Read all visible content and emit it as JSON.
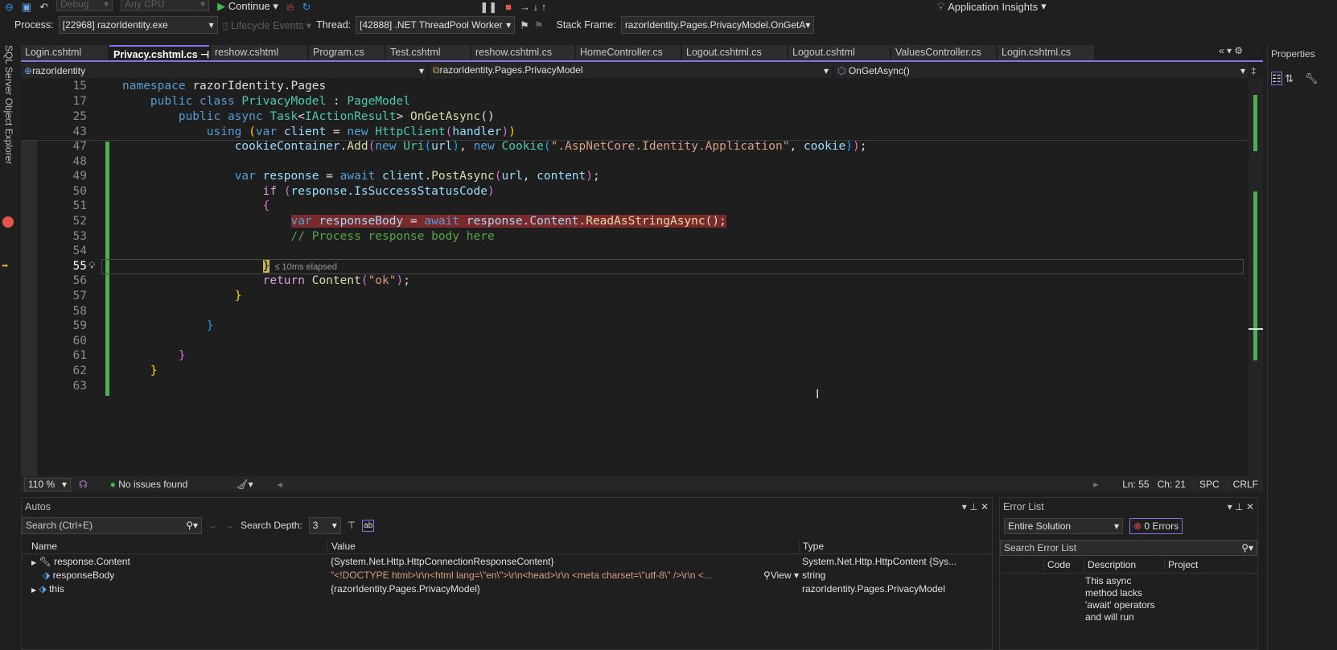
{
  "toolbar": {
    "config": "Debug",
    "platform": "Any CPU",
    "continue": "Continue",
    "app_insights": "Application Insights"
  },
  "debugbar": {
    "process_label": "Process:",
    "process": "[22968] razorIdentity.exe",
    "lifecycle": "Lifecycle Events",
    "thread_label": "Thread:",
    "thread": "[42888] .NET ThreadPool Worker",
    "stack_label": "Stack Frame:",
    "stack": "razorIdentity.Pages.PrivacyModel.OnGetA"
  },
  "left_strip": "SQL Server Object Explorer",
  "tabs": [
    "Login.cshtml",
    "Privacy.cshtml.cs",
    "reshow.cshtml",
    "Program.cs",
    "Test.cshtml",
    "reshow.cshtml.cs",
    "HomeController.cs",
    "Logout.cshtml.cs",
    "Logout.cshtml",
    "ValuesController.cs",
    "Login.cshtml.cs"
  ],
  "navbar": {
    "project": "razorIdentity",
    "type": "razorIdentity.Pages.PrivacyModel",
    "member": "OnGetAsync()"
  },
  "properties": {
    "title": "Properties"
  },
  "sticky": [
    {
      "n": "15",
      "t": [
        [
          "kw",
          "namespace "
        ],
        [
          "pl",
          "razorIdentity.Pages"
        ]
      ]
    },
    {
      "n": "17",
      "t": [
        [
          "pl",
          "    "
        ],
        [
          "kw",
          "public class "
        ],
        [
          "ty",
          "PrivacyModel"
        ],
        [
          "pl",
          " : "
        ],
        [
          "ty",
          "PageModel"
        ]
      ]
    },
    {
      "n": "25",
      "t": [
        [
          "pl",
          "        "
        ],
        [
          "kw",
          "public async "
        ],
        [
          "ty",
          "Task"
        ],
        [
          "pl",
          "<"
        ],
        [
          "ty",
          "IActionResult"
        ],
        [
          "pl",
          "> "
        ],
        [
          "me",
          "OnGetAsync"
        ],
        [
          "pl",
          "()"
        ]
      ]
    },
    {
      "n": "43",
      "t": [
        [
          "pl",
          "            "
        ],
        [
          "kw",
          "using "
        ],
        [
          "br1",
          "("
        ],
        [
          "kw",
          "var "
        ],
        [
          "va",
          "client"
        ],
        [
          "pl",
          " = "
        ],
        [
          "kw",
          "new "
        ],
        [
          "ty",
          "HttpClient"
        ],
        [
          "br2",
          "("
        ],
        [
          "va",
          "handler"
        ],
        [
          "br2",
          ")"
        ],
        [
          "br1",
          ")"
        ]
      ]
    }
  ],
  "code": [
    {
      "n": "47",
      "t": [
        [
          "pl",
          "                "
        ],
        [
          "va",
          "cookieContainer"
        ],
        [
          "pl",
          "."
        ],
        [
          "me",
          "Add"
        ],
        [
          "br2",
          "("
        ],
        [
          "kw",
          "new "
        ],
        [
          "ty",
          "Uri"
        ],
        [
          "br3",
          "("
        ],
        [
          "va",
          "url"
        ],
        [
          "br3",
          ")"
        ],
        [
          "pl",
          ", "
        ],
        [
          "kw",
          "new "
        ],
        [
          "ty",
          "Cookie"
        ],
        [
          "br3",
          "("
        ],
        [
          "st",
          "\".AspNetCore.Identity.Application\""
        ],
        [
          "pl",
          ", "
        ],
        [
          "va",
          "cookie"
        ],
        [
          "br3",
          ")"
        ],
        [
          "br2",
          ")"
        ],
        [
          "pl",
          ";"
        ]
      ]
    },
    {
      "n": "48",
      "t": []
    },
    {
      "n": "49",
      "t": [
        [
          "pl",
          "                "
        ],
        [
          "kw",
          "var "
        ],
        [
          "va",
          "response"
        ],
        [
          "pl",
          " = "
        ],
        [
          "kw",
          "await "
        ],
        [
          "va",
          "client"
        ],
        [
          "pl",
          "."
        ],
        [
          "me",
          "PostAsync"
        ],
        [
          "br2",
          "("
        ],
        [
          "va",
          "url"
        ],
        [
          "pl",
          ", "
        ],
        [
          "va",
          "content"
        ],
        [
          "br2",
          ")"
        ],
        [
          "pl",
          ";"
        ]
      ]
    },
    {
      "n": "50",
      "t": [
        [
          "pl",
          "                    "
        ],
        [
          "ck",
          "if "
        ],
        [
          "br2",
          "("
        ],
        [
          "va",
          "response"
        ],
        [
          "pl",
          "."
        ],
        [
          "va",
          "IsSuccessStatusCode"
        ],
        [
          "br2",
          ")"
        ]
      ]
    },
    {
      "n": "51",
      "t": [
        [
          "pl",
          "                    "
        ],
        [
          "br2",
          "{"
        ]
      ]
    },
    {
      "n": "52",
      "bp": true,
      "t": [
        [
          "pl",
          "                        "
        ],
        [
          "kw",
          "var "
        ],
        [
          "va",
          "responseBody"
        ],
        [
          "pl",
          " = "
        ],
        [
          "kw",
          "await "
        ],
        [
          "va",
          "response"
        ],
        [
          "pl",
          "."
        ],
        [
          "va",
          "Content"
        ],
        [
          "pl",
          "."
        ],
        [
          "me",
          "ReadAsStringAsync"
        ],
        [
          "pl",
          "();"
        ]
      ]
    },
    {
      "n": "53",
      "t": [
        [
          "pl",
          "                        "
        ],
        [
          "cm",
          "// Process response body here"
        ]
      ]
    },
    {
      "n": "54",
      "t": []
    },
    {
      "n": "55",
      "cur": true,
      "t": [
        [
          "pl",
          "                    "
        ],
        [
          "br2",
          "}"
        ]
      ],
      "hint": "≤ 10ms elapsed"
    },
    {
      "n": "56",
      "t": [
        [
          "pl",
          "                    "
        ],
        [
          "ck",
          "return "
        ],
        [
          "me",
          "Content"
        ],
        [
          "br2",
          "("
        ],
        [
          "st",
          "\"ok\""
        ],
        [
          "br2",
          ")"
        ],
        [
          "pl",
          ";"
        ]
      ]
    },
    {
      "n": "57",
      "t": [
        [
          "pl",
          "                "
        ],
        [
          "br1",
          "}"
        ]
      ]
    },
    {
      "n": "58",
      "t": []
    },
    {
      "n": "59",
      "t": [
        [
          "pl",
          "            "
        ],
        [
          "br3",
          "}"
        ]
      ]
    },
    {
      "n": "60",
      "t": []
    },
    {
      "n": "61",
      "t": [
        [
          "pl",
          "        "
        ],
        [
          "br2",
          "}"
        ]
      ]
    },
    {
      "n": "62",
      "t": [
        [
          "pl",
          "    "
        ],
        [
          "br1",
          "}"
        ]
      ]
    },
    {
      "n": "63",
      "t": []
    }
  ],
  "status": {
    "zoom": "110 %",
    "issues": "No issues found",
    "ln": "Ln: 55",
    "ch": "Ch: 21",
    "spc": "SPC",
    "crlf": "CRLF"
  },
  "autos": {
    "title": "Autos",
    "search_placeholder": "Search (Ctrl+E)",
    "depth_label": "Search Depth:",
    "depth": "3",
    "cols": [
      "Name",
      "Value",
      "Type"
    ],
    "rows": [
      {
        "name": "response.Content",
        "value": "{System.Net.Http.HttpConnectionResponseContent}",
        "type": "System.Net.Http.HttpContent {Sys..."
      },
      {
        "name": "responseBody",
        "value": "\"<!DOCTYPE html>\\r\\n<html lang=\\\"en\\\">\\r\\n<head>\\r\\n    <meta charset=\\\"utf-8\\\" />\\r\\n    <...",
        "type": "string",
        "view": "View"
      },
      {
        "name": "this",
        "value": "{razorIdentity.Pages.PrivacyModel}",
        "type": "razorIdentity.Pages.PrivacyModel"
      }
    ]
  },
  "errors": {
    "title": "Error List",
    "scope": "Entire Solution",
    "count": "0 Errors",
    "search": "Search Error List",
    "cols": [
      "Code",
      "Description",
      "Project"
    ],
    "desc": "This async method lacks 'await' operators and will run synchronously. Consider using the 'await'..."
  }
}
